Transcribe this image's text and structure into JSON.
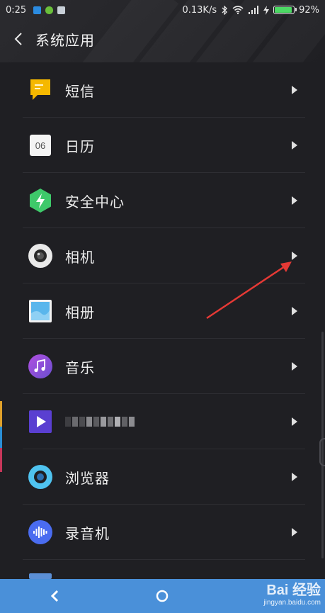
{
  "status_bar": {
    "time": "0:25",
    "network_speed": "0.13K/s",
    "battery_percent": "92%",
    "battery_level": 0.92,
    "icons": [
      "app-notification-icon",
      "frog-app-icon",
      "message-app-icon",
      "bluetooth-icon",
      "wifi-icon",
      "signal-icon",
      "charging-icon",
      "battery-icon"
    ]
  },
  "header": {
    "title": "系统应用",
    "back_icon": "chevron-left-icon"
  },
  "apps": [
    {
      "label": "短信",
      "icon": "sms-icon",
      "icon_color": "#f5b800"
    },
    {
      "label": "日历",
      "icon": "calendar-icon",
      "icon_text": "06",
      "icon_color": "#f4f4f4"
    },
    {
      "label": "安全中心",
      "icon": "security-center-icon",
      "icon_color": "#3ec96a"
    },
    {
      "label": "相机",
      "icon": "camera-icon",
      "icon_color": "#e9e9e9"
    },
    {
      "label": "相册",
      "icon": "gallery-icon",
      "icon_color": "#5ab6ec"
    },
    {
      "label": "音乐",
      "icon": "music-icon",
      "icon_color": "#8b4fd6"
    },
    {
      "label": "",
      "icon": "video-icon",
      "icon_color": "#5a3fd1",
      "label_obscured": true
    },
    {
      "label": "浏览器",
      "icon": "browser-icon",
      "icon_color": "#4fc3f0"
    },
    {
      "label": "录音机",
      "icon": "recorder-icon",
      "icon_color": "#4a6cf0"
    }
  ],
  "row_chevron_icon": "chevron-right-icon",
  "annotation": {
    "type": "red-arrow",
    "points_to": "camera chevron",
    "color": "#e53935"
  },
  "nav_bar": {
    "back_icon": "back-arrow-icon",
    "home_icon": "home-circle-icon",
    "color": "#4a90d9"
  },
  "watermark": {
    "top": "Bai 经验",
    "bottom": "jingyan.baidu.com"
  }
}
